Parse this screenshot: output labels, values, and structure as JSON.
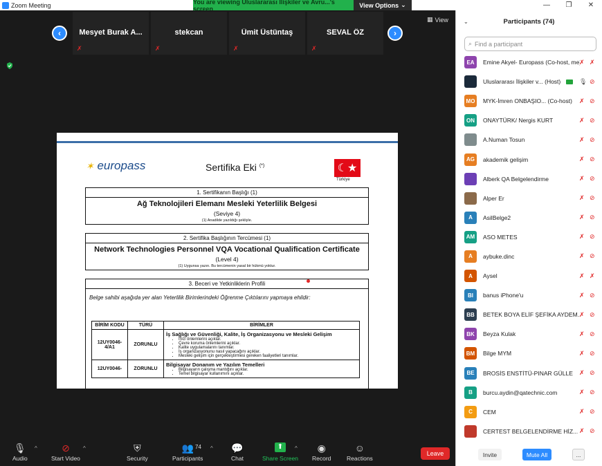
{
  "window": {
    "title": "Zoom Meeting",
    "min": "—",
    "restore": "❐",
    "close": "✕"
  },
  "banner": {
    "text": "You are viewing Uluslararası İlişkiler ve Avru...'s screen",
    "view_options": "View Options",
    "caret": "⌄"
  },
  "view_button": {
    "label": "View",
    "icon": "▦"
  },
  "thumbnails": [
    {
      "name": "Mesyet Burak A..."
    },
    {
      "name": "stekcan"
    },
    {
      "name": "Ümit Üstüntaş"
    },
    {
      "name": "SEVAL ÖZ"
    }
  ],
  "nav": {
    "prev": "‹",
    "next": "›"
  },
  "document": {
    "logo": "europass",
    "title_main": "Sertifika Eki",
    "title_sup": "(*)",
    "country": "Türkiye",
    "flag_symbol": "☾★",
    "box1_header": "1. Sertifikanın Başlığı (1)",
    "box1_title": "Ağ Teknolojileri Elemanı Mesleki Yeterlilik Belgesi",
    "box1_level": "(Seviye 4)",
    "box1_note": "(1) Anadilde yazıldığı şekliyle.",
    "box2_header": "2. Sertifika Başlığının Tercümesi (1)",
    "box2_title": "Network Technologies Personnel VQA Vocational Qualification Certificate",
    "box2_level": "(Level 4)",
    "box2_note": "(1) Uygunsa yazın. Bu tercümenin yasal bir hükmü yoktur.",
    "box3_header": "3. Beceri ve Yetkinliklerin Profili",
    "box3_intro": "Belge sahibi aşağıda yer alan Yeterlilik Birimlerindeki Öğrenme Çıktılarını yapmaya ehildir:",
    "table": {
      "headers": [
        "BİRİM KODU",
        "TÜRÜ",
        "BİRİMLER"
      ],
      "rows": [
        {
          "code": "12UY0046-4/A1",
          "type": "ZORUNLU",
          "title": "İş Sağlığı ve Güvenliği, Kalite, İş Organizasyonu ve Mesleki Gelişim",
          "items": [
            "İSG önlemlerini açıklar.",
            "Çevre koruma önlemlerini açıklar.",
            "Kalite uygulamalarını tanımlar.",
            "İş organizasyonunu nasıl yapacağını açıklar.",
            "Mesleki gelişim için gerçekleştirmesi gereken faaliyetleri tanımlar."
          ]
        },
        {
          "code": "12UY0046-",
          "type": "ZORUNLU",
          "title": "Bilgisayar Donanım ve Yazılım Temelleri",
          "items": [
            "Bilgisayarın çalışma mantığını açıklar.",
            "Temel bilgisayar kullanımını açıklar."
          ]
        }
      ]
    }
  },
  "toolbar": {
    "audio": "Audio",
    "start_video": "Start Video",
    "security": "Security",
    "participants": "Participants",
    "participants_count": "74",
    "chat": "Chat",
    "share_screen": "Share Screen",
    "record": "Record",
    "reactions": "Reactions",
    "leave": "Leave",
    "caret": "^"
  },
  "panel": {
    "title": "Participants (74)",
    "chevron": "⌄",
    "search_placeholder": "Find a participant",
    "search_icon": "⌕",
    "participants": [
      {
        "initials": "EA",
        "color": "#8e44ad",
        "name": "Emine Akyel- Europass (Co-host, me)",
        "video_icon": false
      },
      {
        "initials": "",
        "color": "#1b2a3a",
        "name": "Uluslararası İlişkiler v... (Host)",
        "video_icon": true,
        "host": true
      },
      {
        "initials": "MO",
        "color": "#e67e22",
        "name": "MYK-İmren ONBAŞIO... (Co-host)",
        "video_icon": true
      },
      {
        "initials": "ON",
        "color": "#16a085",
        "name": " ONAYTÜRK/ Nergis KURT",
        "video_icon": true
      },
      {
        "initials": "",
        "color": "#7f8c8d",
        "name": "A.Numan Tosun",
        "video_icon": true
      },
      {
        "initials": "AG",
        "color": "#e67e22",
        "name": "akademik gelişim",
        "video_icon": true
      },
      {
        "initials": "",
        "color": "#6c3fb5",
        "name": "Alberk QA Belgelendirme",
        "video_icon": true
      },
      {
        "initials": "",
        "color": "#8b6a4a",
        "name": "Alper Er",
        "video_icon": true
      },
      {
        "initials": "A",
        "color": "#2980b9",
        "name": "AsilBelge2",
        "video_icon": true
      },
      {
        "initials": "AM",
        "color": "#16a085",
        "name": "ASO METES",
        "video_icon": true
      },
      {
        "initials": "A",
        "color": "#e67e22",
        "name": "aybuke.dinc",
        "video_icon": true
      },
      {
        "initials": "A",
        "color": "#d35400",
        "name": "Aysel",
        "video_icon": false
      },
      {
        "initials": "BI",
        "color": "#2980b9",
        "name": "banus iPhone'u",
        "video_icon": true
      },
      {
        "initials": "BB",
        "color": "#2c3e50",
        "name": "BETEK BOYA ELİF ŞEFİKA AYDEM...",
        "video_icon": true
      },
      {
        "initials": "BK",
        "color": "#8e44ad",
        "name": "Beyza Kulak",
        "video_icon": true
      },
      {
        "initials": "BM",
        "color": "#d35400",
        "name": "Bilge MYM",
        "video_icon": true
      },
      {
        "initials": "BE",
        "color": "#2980b9",
        "name": "BROSİS ENSTİTÜ-PINAR GÜLLE",
        "video_icon": true
      },
      {
        "initials": "B",
        "color": "#16a085",
        "name": "burcu.aydin@qatechnic.com",
        "video_icon": true
      },
      {
        "initials": "C",
        "color": "#f39c12",
        "name": "CEM",
        "video_icon": true
      },
      {
        "initials": "",
        "color": "#c0392b",
        "name": "CERTEST BELGELENDİRME HİZ...",
        "video_icon": true
      }
    ],
    "mic_off_icon": "✗",
    "video_off_icon": "⊘",
    "invite": "Invite",
    "mute_all": "Mute All",
    "more": "..."
  },
  "colors": {
    "accent": "#2d8cff",
    "share_green": "#22b14c",
    "leave_red": "#e02828",
    "muted_red": "#e02828"
  }
}
